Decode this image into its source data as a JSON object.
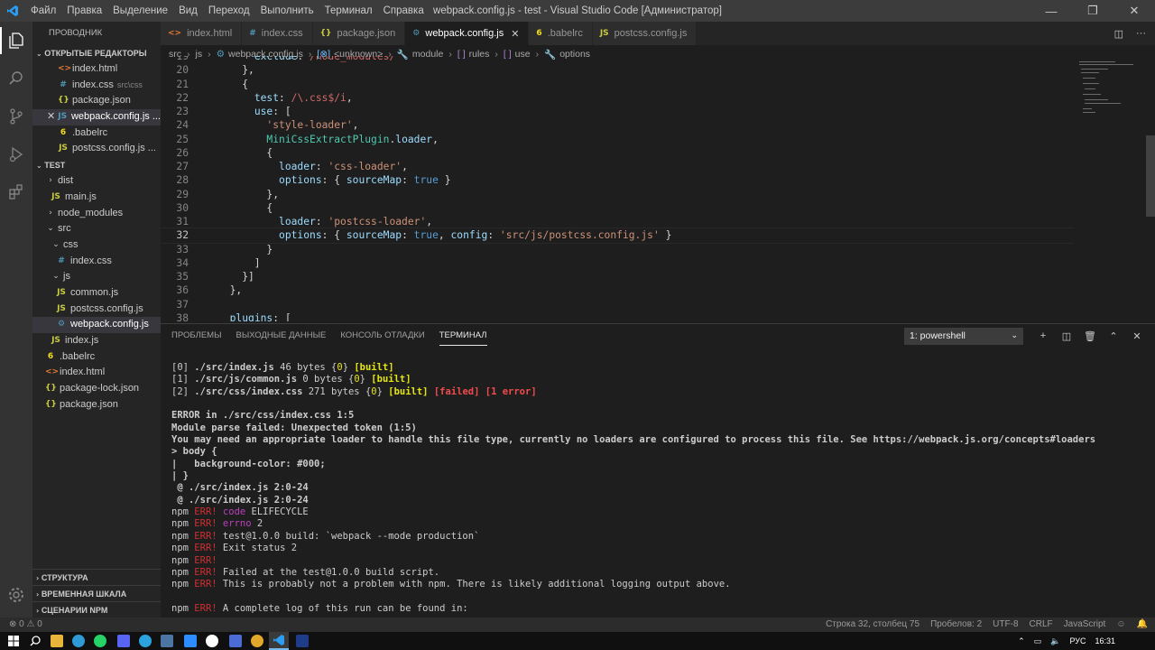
{
  "titlebar": {
    "menu": [
      "Файл",
      "Правка",
      "Выделение",
      "Вид",
      "Переход",
      "Выполнить",
      "Терминал",
      "Справка"
    ],
    "title": "webpack.config.js - test - Visual Studio Code [Администратор]"
  },
  "sidebar": {
    "header": "ПРОВОДНИК",
    "open_editors_title": "ОТКРЫТЫЕ РЕДАКТОРЫ",
    "open_editors": [
      {
        "icon": "<>",
        "label": "index.html",
        "hint": ""
      },
      {
        "icon": "#",
        "label": "index.css",
        "hint": "src\\css"
      },
      {
        "icon": "{}",
        "label": "package.json",
        "hint": ""
      },
      {
        "icon": "JS",
        "label": "webpack.config.js ...",
        "hint": ""
      },
      {
        "icon": "6",
        "label": ".babelrc",
        "hint": ""
      },
      {
        "icon": "JS",
        "label": "postcss.config.js ...",
        "hint": ""
      }
    ],
    "project_title": "TEST",
    "tree": [
      {
        "chev": "›",
        "icon": "",
        "label": "dist"
      },
      {
        "chev": "",
        "icon": "JS",
        "label": "main.js"
      },
      {
        "chev": "›",
        "icon": "",
        "label": "node_modules"
      },
      {
        "chev": "⌄",
        "icon": "",
        "label": "src"
      },
      {
        "chev": "⌄",
        "icon": "",
        "label": "css"
      },
      {
        "chev": "",
        "icon": "#",
        "label": "index.css"
      },
      {
        "chev": "⌄",
        "icon": "",
        "label": "js"
      },
      {
        "chev": "",
        "icon": "JS",
        "label": "common.js"
      },
      {
        "chev": "",
        "icon": "JS",
        "label": "postcss.config.js"
      },
      {
        "chev": "",
        "icon": "⚙",
        "label": "webpack.config.js"
      },
      {
        "chev": "",
        "icon": "JS",
        "label": "index.js"
      },
      {
        "chev": "",
        "icon": "6",
        "label": ".babelrc"
      },
      {
        "chev": "",
        "icon": "<>",
        "label": "index.html"
      },
      {
        "chev": "",
        "icon": "{}",
        "label": "package-lock.json"
      },
      {
        "chev": "",
        "icon": "{}",
        "label": "package.json"
      }
    ],
    "bottom_sections": [
      "СТРУКТУРА",
      "ВРЕМЕННАЯ ШКАЛА",
      "СЦЕНАРИИ NPM"
    ]
  },
  "tabs": [
    {
      "icon": "<>",
      "label": "index.html"
    },
    {
      "icon": "#",
      "label": "index.css"
    },
    {
      "icon": "{}",
      "label": "package.json"
    },
    {
      "icon": "⚙",
      "label": "webpack.config.js"
    },
    {
      "icon": "6",
      "label": ".babelrc"
    },
    {
      "icon": "JS",
      "label": "postcss.config.js"
    }
  ],
  "breadcrumb": [
    "src",
    "js",
    "webpack.config.js",
    "<unknown>",
    "module",
    "rules",
    "use",
    "options"
  ],
  "panel": {
    "tabs": [
      "ПРОБЛЕМЫ",
      "ВЫХОДНЫЕ ДАННЫЕ",
      "КОНСОЛЬ ОТЛАДКИ",
      "ТЕРМИНАЛ"
    ],
    "terminal_select": "1: powershell"
  },
  "statusbar": {
    "left": "⊗ 0 ⚠ 0",
    "right": [
      "Строка 32, столбец 75",
      "Пробелов: 2",
      "UTF-8",
      "CRLF",
      "JavaScript",
      "☺",
      "🔔"
    ]
  },
  "taskbar": {
    "lang": "РУС",
    "time": "16:31"
  },
  "colors": {
    "accent": "#007acc",
    "error": "#f14c4c",
    "warning_yellow": "#e5e510"
  }
}
